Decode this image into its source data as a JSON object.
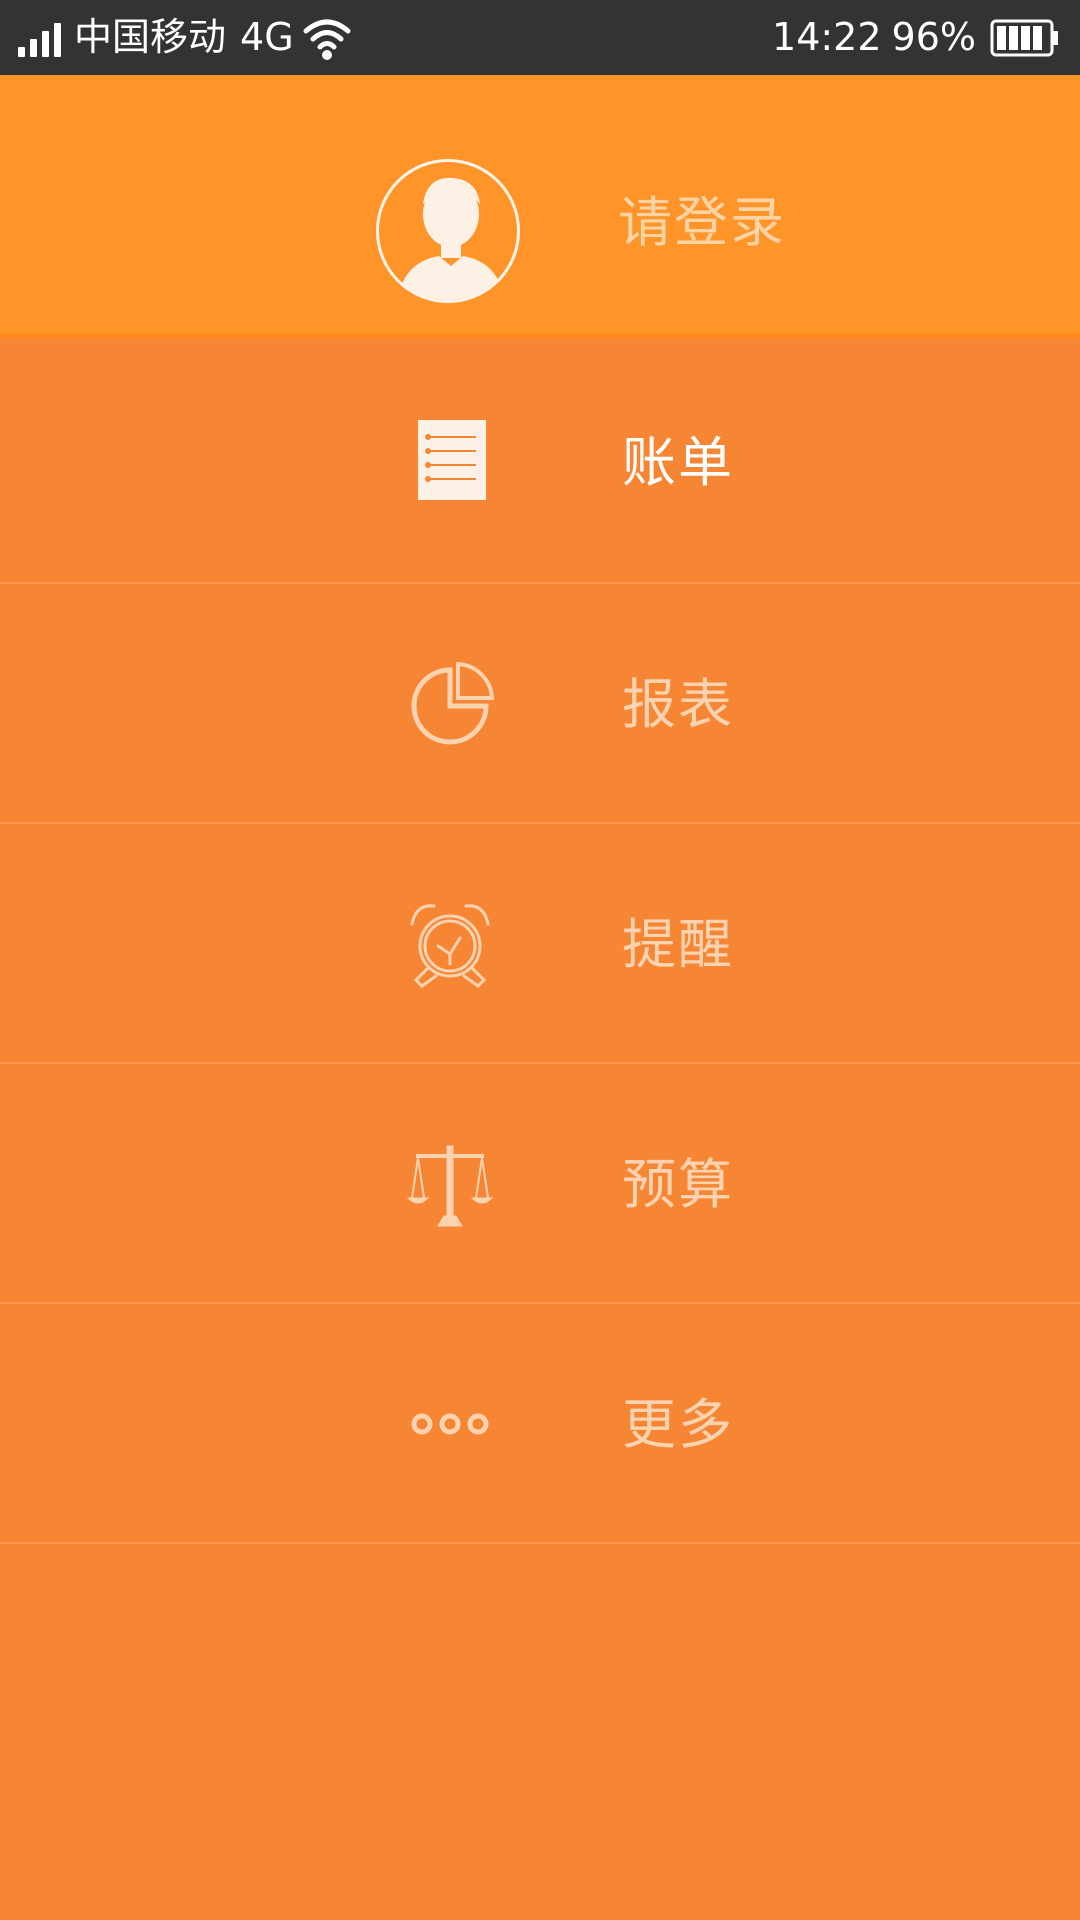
{
  "status_bar": {
    "carrier": "中国移动",
    "network": "4G",
    "time": "14:22",
    "battery": "96%",
    "icons": [
      "signal-icon",
      "wifi-icon",
      "battery-icon"
    ]
  },
  "header": {
    "login_label": "请登录",
    "avatar_icon": "user-avatar-icon"
  },
  "menu": {
    "items": [
      {
        "label": "账单",
        "icon": "bill-list-icon",
        "active": true
      },
      {
        "label": "报表",
        "icon": "pie-chart-icon",
        "active": false
      },
      {
        "label": "提醒",
        "icon": "alarm-clock-icon",
        "active": false
      },
      {
        "label": "预算",
        "icon": "balance-scale-icon",
        "active": false
      },
      {
        "label": "更多",
        "icon": "more-dots-icon",
        "active": false
      }
    ]
  },
  "colors": {
    "status_bar_bg": "#333333",
    "header_bg": "#ff9428",
    "menu_bg": "#f68534",
    "divider": "#fb9a4c",
    "label_inactive": "#fcd3b0",
    "label_active": "#ffffff"
  }
}
